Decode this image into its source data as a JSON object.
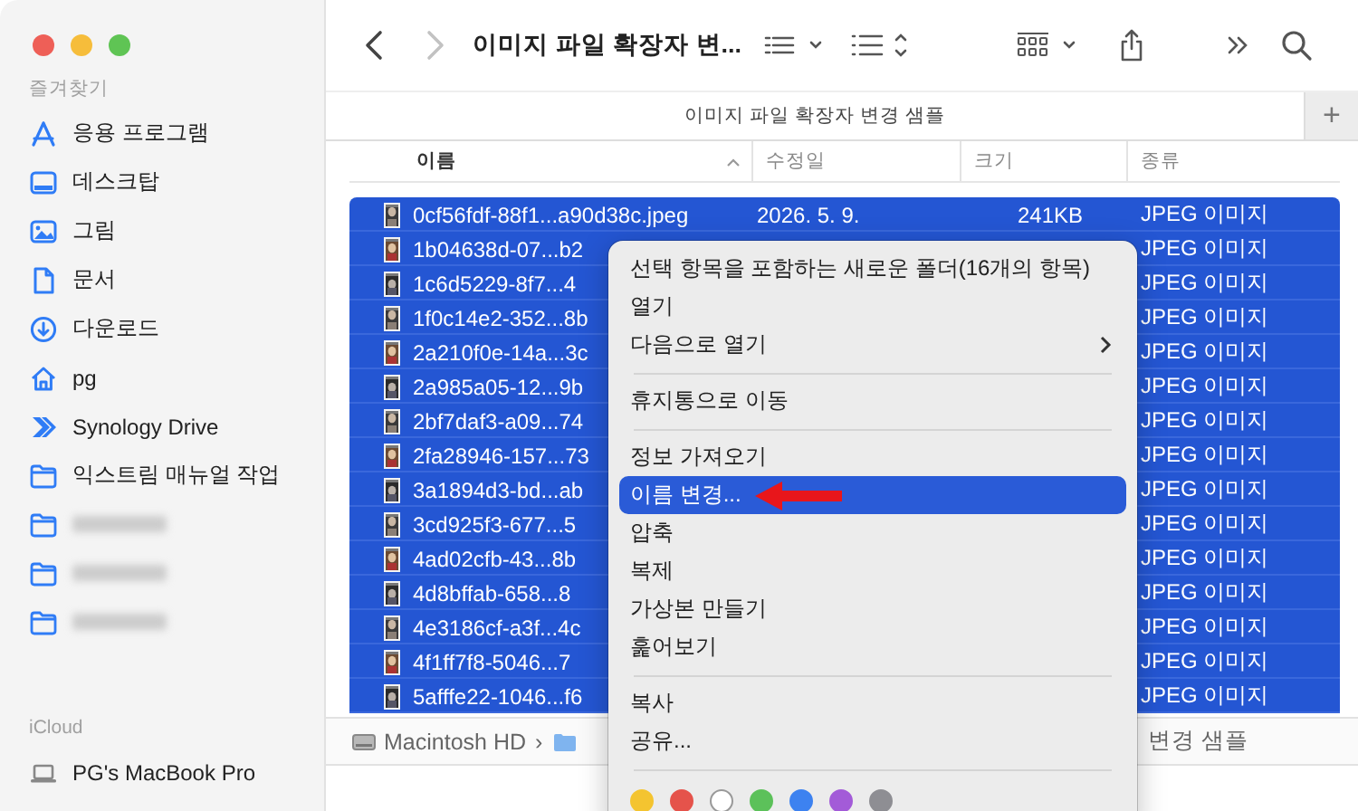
{
  "window": {
    "title": "이미지 파일 확장자 변..."
  },
  "sidebar": {
    "items": [
      {
        "kind": "header",
        "label": "즐겨찾기"
      },
      {
        "kind": "apps",
        "label": "응용 프로그램"
      },
      {
        "kind": "desktop",
        "label": "데스크탑"
      },
      {
        "kind": "pictures",
        "label": "그림"
      },
      {
        "kind": "document",
        "label": "문서"
      },
      {
        "kind": "download",
        "label": "다운로드"
      },
      {
        "kind": "home",
        "label": "pg"
      },
      {
        "kind": "synology",
        "label": "Synology Drive"
      },
      {
        "kind": "folder",
        "label": "익스트림 매뉴얼 작업"
      },
      {
        "kind": "blurred"
      },
      {
        "kind": "blurred"
      },
      {
        "kind": "blurred"
      },
      {
        "kind": "header",
        "label": "iCloud"
      },
      {
        "kind": "laptop",
        "label": "PG's MacBook Pro"
      }
    ]
  },
  "toolbar": {
    "back": {
      "disabled": false
    },
    "forward": {
      "disabled": true
    }
  },
  "tabs": [
    {
      "label": "이미지 파일 확장자 변경 샘플",
      "selected": true
    }
  ],
  "new_tab": "+",
  "columns": [
    {
      "label": "이름",
      "sorted": true
    },
    {
      "label": "수정일",
      "sorted": false
    },
    {
      "label": "크기",
      "sorted": false
    },
    {
      "label": "종류",
      "sorted": false
    }
  ],
  "rows": [
    {
      "name": "0cf56fdf-88f1...a90d38c.jpeg",
      "modified": "2026. 5. 9.",
      "size": "241KB",
      "file_type": "JPEG 이미지",
      "selected": true
    },
    {
      "name": "1b04638d-07...b2",
      "file_type": "JPEG 이미지",
      "selected": true
    },
    {
      "name": "1c6d5229-8f7...4",
      "file_type": "JPEG 이미지",
      "selected": true
    },
    {
      "name": "1f0c14e2-352...8b",
      "file_type": "JPEG 이미지",
      "selected": true
    },
    {
      "name": "2a210f0e-14a...3c",
      "file_type": "JPEG 이미지",
      "selected": true
    },
    {
      "name": "2a985a05-12...9b",
      "file_type": "JPEG 이미지",
      "selected": true
    },
    {
      "name": "2bf7daf3-a09...74",
      "file_type": "JPEG 이미지",
      "selected": true
    },
    {
      "name": "2fa28946-157...73",
      "file_type": "JPEG 이미지",
      "selected": true
    },
    {
      "name": "3a1894d3-bd...ab",
      "file_type": "JPEG 이미지",
      "selected": true
    },
    {
      "name": "3cd925f3-677...5",
      "file_type": "JPEG 이미지",
      "selected": true
    },
    {
      "name": "4ad02cfb-43...8b",
      "file_type": "JPEG 이미지",
      "selected": true
    },
    {
      "name": "4d8bffab-658...8",
      "file_type": "JPEG 이미지",
      "selected": true
    },
    {
      "name": "4e3186cf-a3f...4c",
      "file_type": "JPEG 이미지",
      "selected": true
    },
    {
      "name": "4f1ff7f8-5046...7",
      "file_type": "JPEG 이미지",
      "selected": true
    },
    {
      "name": "5afffe22-1046...f6",
      "file_type": "JPEG 이미지",
      "selected": true
    }
  ],
  "path_bar": {
    "separator": "›",
    "items": [
      {
        "kind": "disk",
        "label": "Macintosh HD"
      },
      {
        "kind": "folder"
      }
    ],
    "tail": "변경 샘플"
  },
  "context_menu": {
    "items": [
      {
        "kind": "item",
        "label": "선택 항목을 포함하는 새로운 폴더(16개의 항목)",
        "selected": false,
        "submenu": false,
        "arrow": false
      },
      {
        "kind": "item",
        "label": "열기",
        "selected": false,
        "submenu": false,
        "arrow": false
      },
      {
        "kind": "item",
        "label": "다음으로 열기",
        "selected": false,
        "submenu": true,
        "arrow": false
      },
      {
        "kind": "separator"
      },
      {
        "kind": "item",
        "label": "휴지통으로 이동",
        "selected": false,
        "submenu": false,
        "arrow": false
      },
      {
        "kind": "separator"
      },
      {
        "kind": "item",
        "label": "정보 가져오기",
        "selected": false,
        "submenu": false,
        "arrow": false
      },
      {
        "kind": "item",
        "label": "이름 변경...",
        "selected": true,
        "submenu": false,
        "arrow": true
      },
      {
        "kind": "item",
        "label": "압축",
        "selected": false,
        "submenu": false,
        "arrow": false
      },
      {
        "kind": "item",
        "label": "복제",
        "selected": false,
        "submenu": false,
        "arrow": false
      },
      {
        "kind": "item",
        "label": "가상본 만들기",
        "selected": false,
        "submenu": false,
        "arrow": false
      },
      {
        "kind": "item",
        "label": "훑어보기",
        "selected": false,
        "submenu": false,
        "arrow": false
      },
      {
        "kind": "separator"
      },
      {
        "kind": "item",
        "label": "복사",
        "selected": false,
        "submenu": false,
        "arrow": false
      },
      {
        "kind": "item",
        "label": "공유...",
        "selected": false,
        "submenu": false,
        "arrow": false
      },
      {
        "kind": "separator"
      },
      {
        "kind": "colors",
        "colors": [
          {
            "color": "#f4c430"
          },
          {
            "color": "#e5534b"
          },
          {
            "color": "#ffffff"
          },
          {
            "color": "#5cc15a"
          },
          {
            "color": "#3d82f0"
          },
          {
            "color": "#a35bd8"
          },
          {
            "color": "#8e8e93"
          }
        ]
      }
    ]
  }
}
